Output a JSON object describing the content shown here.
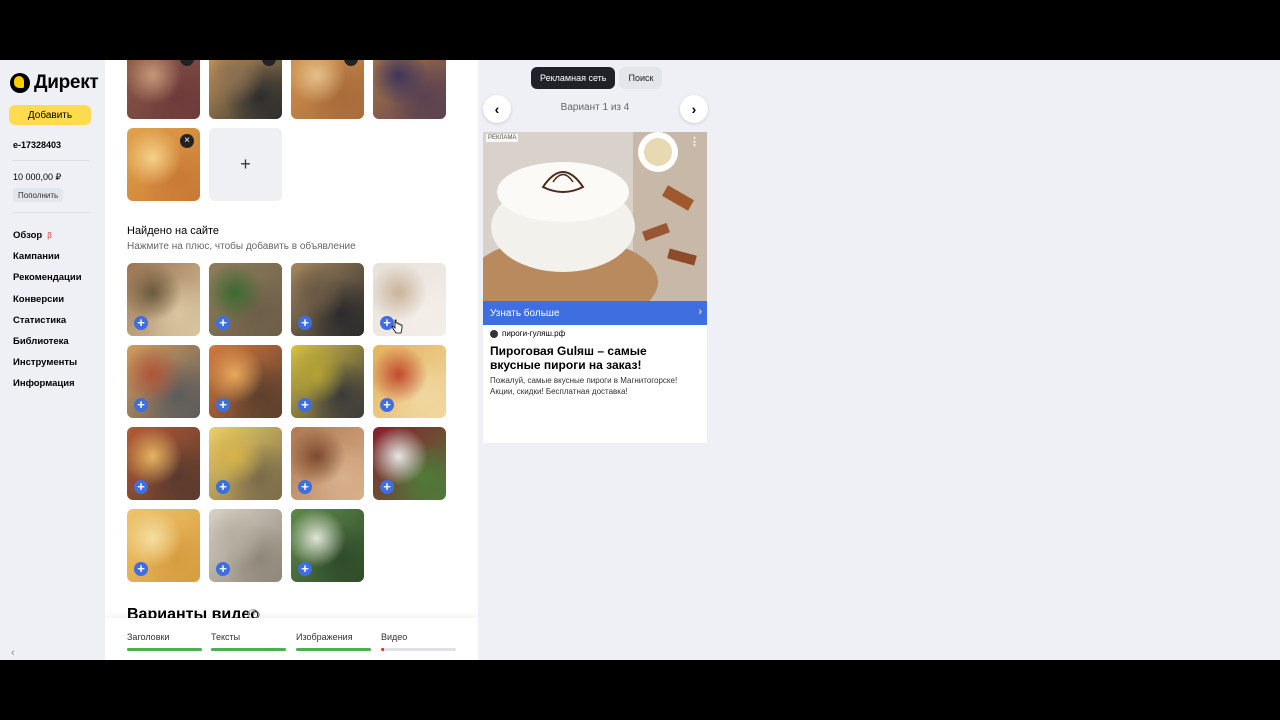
{
  "brand": {
    "name": "Директ"
  },
  "sidebar": {
    "add_label": "Добавить",
    "account": "e-17328403",
    "balance": "10 000,00 ₽",
    "topup_label": "Пополнить",
    "beta_label": "β",
    "nav": [
      {
        "label": "Обзор"
      },
      {
        "label": "Кампании"
      },
      {
        "label": "Рекомендации"
      },
      {
        "label": "Конверсии"
      },
      {
        "label": "Статистика"
      },
      {
        "label": "Библиотека"
      },
      {
        "label": "Инструменты"
      },
      {
        "label": "Информация"
      }
    ]
  },
  "images": {
    "selected": [
      {
        "alt": "slice of berry pie",
        "colors": [
          "#8a5a48",
          "#c69879",
          "#6e3b3b"
        ]
      },
      {
        "alt": "meat pie with filling",
        "colors": [
          "#cf9f5e",
          "#8b6f52",
          "#2d2d2d"
        ]
      },
      {
        "alt": "cut chicken pie",
        "colors": [
          "#d2944f",
          "#e5c08a",
          "#a86b3a"
        ]
      },
      {
        "alt": "blueberry pie",
        "colors": [
          "#b07a48",
          "#3c355c",
          "#5a4150"
        ]
      },
      {
        "alt": "apple pie slice",
        "colors": [
          "#e2a24b",
          "#f5d088",
          "#c97a35"
        ]
      }
    ],
    "add_tile_symbol": "+",
    "found_title": "Найдено на сайте",
    "found_hint": "Нажмите на плюс, чтобы добавить в объявление",
    "found": [
      {
        "alt": "roll pie with mushrooms",
        "colors": [
          "#9c7351",
          "#6b5a3e",
          "#d8c6a0"
        ]
      },
      {
        "alt": "meat pie on greens",
        "colors": [
          "#8e7d5c",
          "#3c6b2f",
          "#6d5f48"
        ]
      },
      {
        "alt": "open meat pie",
        "colors": [
          "#a5875f",
          "#6a5943",
          "#2b2b2b"
        ]
      },
      {
        "alt": "cream cake",
        "colors": [
          "#e6e1da",
          "#c9b39a",
          "#f3efe8"
        ]
      },
      {
        "alt": "pizza slices",
        "colors": [
          "#d39b5b",
          "#b0553a",
          "#5c5c5c"
        ]
      },
      {
        "alt": "tomato quiche",
        "colors": [
          "#d4783f",
          "#e8a85a",
          "#5b3f2d"
        ]
      },
      {
        "alt": "cheese quiche",
        "colors": [
          "#d9c143",
          "#b4a233",
          "#3a3a3a"
        ]
      },
      {
        "alt": "vegetable pizza",
        "colors": [
          "#e4b45c",
          "#c04a2e",
          "#f0d7a0"
        ]
      },
      {
        "alt": "pepperoni pizza",
        "colors": [
          "#b45a35",
          "#e5b460",
          "#5a3a2e"
        ]
      },
      {
        "alt": "round cheese pie",
        "colors": [
          "#edd066",
          "#d6b24a",
          "#7a6b4a"
        ]
      },
      {
        "alt": "chocolate cookies",
        "colors": [
          "#b07a52",
          "#7c4b2f",
          "#d8b08c"
        ]
      },
      {
        "alt": "beet salad",
        "colors": [
          "#8b1e2e",
          "#e6e6e6",
          "#4f7a3a"
        ]
      },
      {
        "alt": "cheese puff pastry",
        "colors": [
          "#efc46a",
          "#f5dea0",
          "#d79c40"
        ]
      },
      {
        "alt": "dumplings",
        "colors": [
          "#d8d2c6",
          "#b5ad9f",
          "#8f877a"
        ]
      },
      {
        "alt": "green salad",
        "colors": [
          "#5f8a4a",
          "#e0e4d8",
          "#2f4b2a"
        ]
      }
    ],
    "video_title": "Варианты видео"
  },
  "progress": [
    {
      "label": "Заголовки",
      "fill": 1.0,
      "color": "#4caf50"
    },
    {
      "label": "Тексты",
      "fill": 1.0,
      "color": "#4caf50"
    },
    {
      "label": "Изображения",
      "fill": 1.0,
      "color": "#4caf50"
    },
    {
      "label": "Видео",
      "fill": 0.04,
      "color": "#e53935"
    }
  ],
  "preview": {
    "tabs": [
      {
        "label": "Рекламная сеть",
        "active": true
      },
      {
        "label": "Поиск",
        "active": false
      }
    ],
    "prev_symbol": "‹",
    "next_symbol": "›",
    "variant": "Вариант 1 из 4",
    "ad": {
      "badge": "РЕКЛАМА",
      "menu_symbol": "⋮",
      "cta": "Узнать больше",
      "cta_chevron": "›",
      "domain": "пироги-гуляш.рф",
      "title": "Пироговая Gulяш – самые вкусные пироги на заказ!",
      "text": "Пожалуй, самые вкусные пироги в Магнитогорске! Акции, скидки! Бесплатная доставка!"
    }
  }
}
